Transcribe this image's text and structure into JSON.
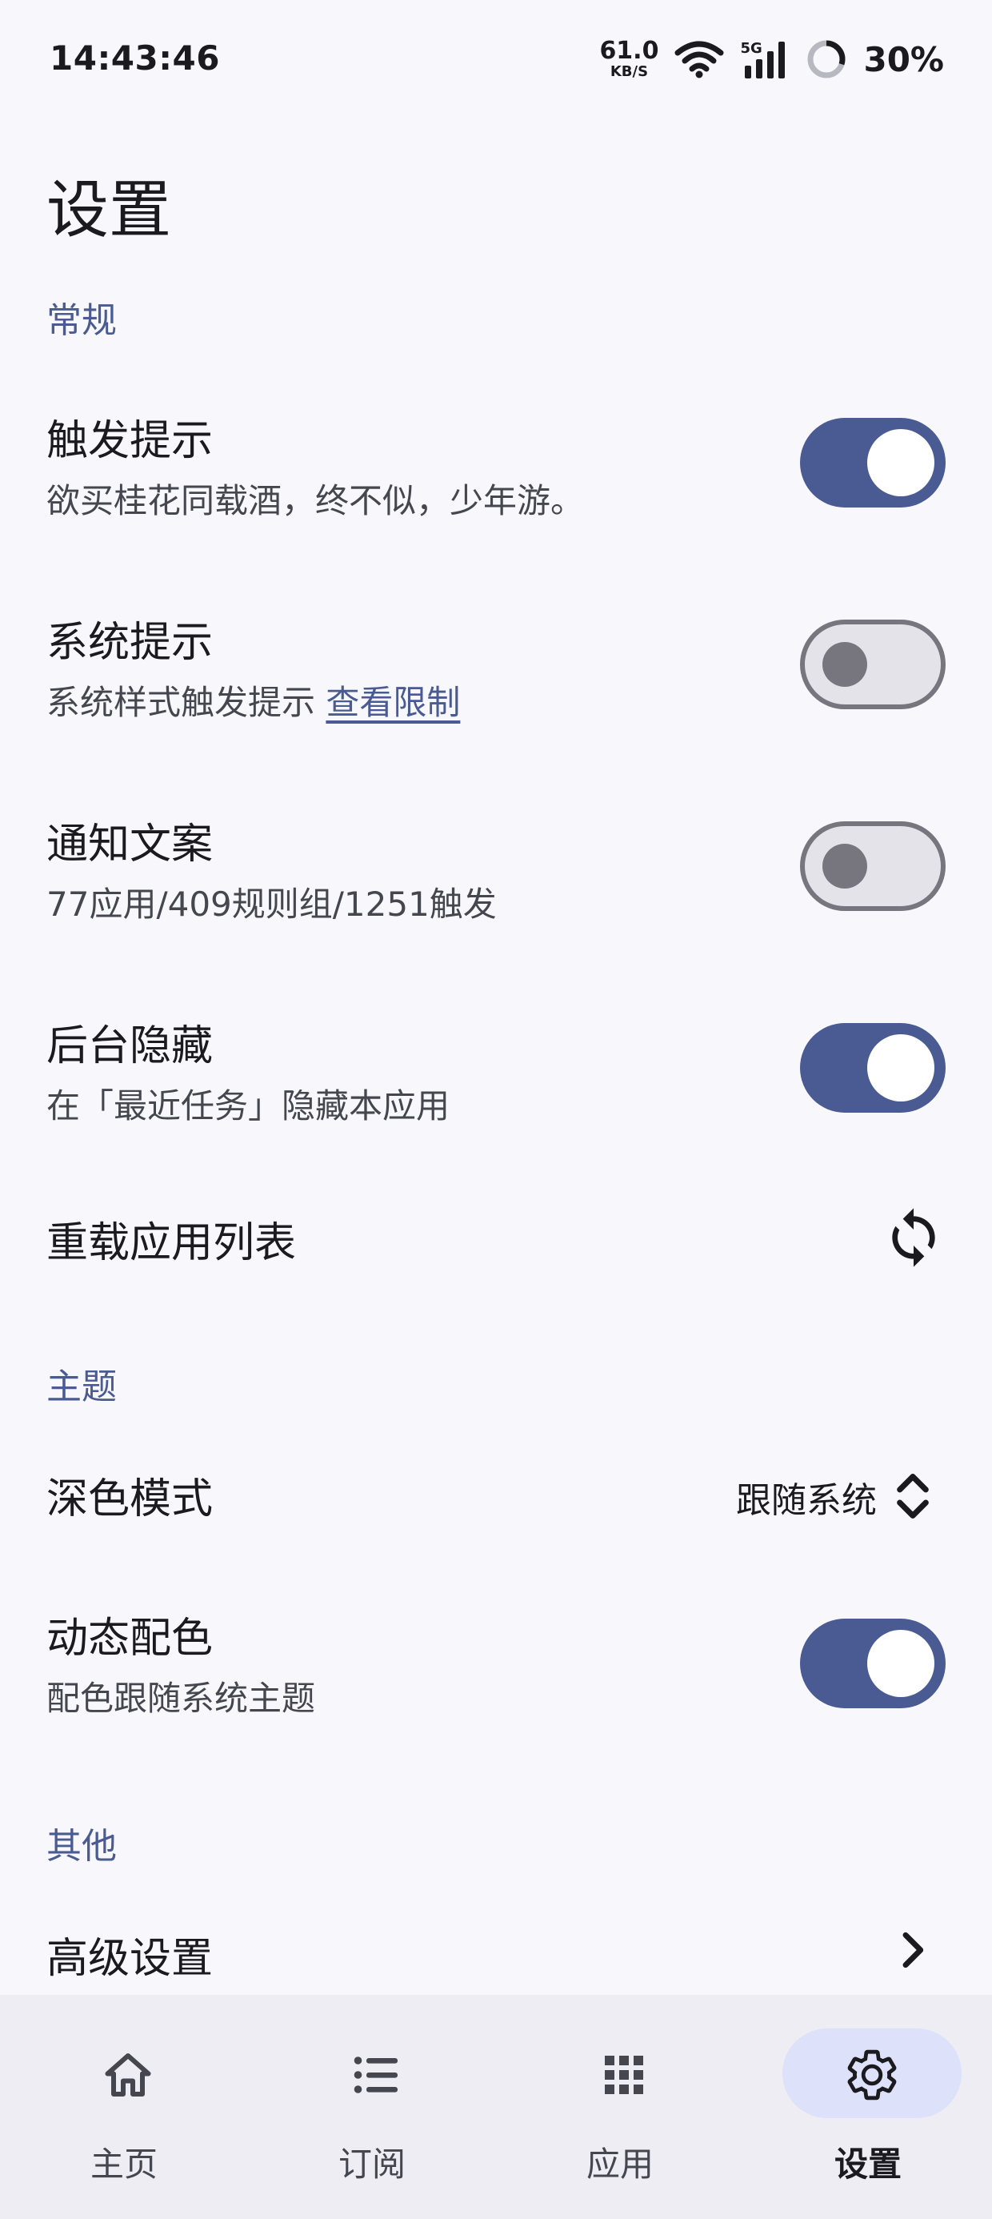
{
  "status_bar": {
    "time": "14:43:46",
    "net_speed_value": "61.0",
    "net_speed_unit": "KB/S",
    "network_type": "5G",
    "battery_percent": "30%",
    "battery_level": 0.3
  },
  "page": {
    "title": "设置"
  },
  "sections": {
    "general": {
      "header": "常规",
      "trigger_tip": {
        "title": "触发提示",
        "subtitle": "欲买桂花同载酒，终不似，少年游。",
        "enabled": true
      },
      "system_tip": {
        "title": "系统提示",
        "subtitle": "系统样式触发提示",
        "link": "查看限制",
        "enabled": false
      },
      "notification_copy": {
        "title": "通知文案",
        "subtitle": "77应用/409规则组/1251触发",
        "enabled": false
      },
      "background_hide": {
        "title": "后台隐藏",
        "subtitle": "在「最近任务」隐藏本应用",
        "enabled": true
      },
      "reload_apps": {
        "title": "重载应用列表",
        "icon": "refresh-icon"
      }
    },
    "theme": {
      "header": "主题",
      "dark_mode": {
        "title": "深色模式",
        "value": "跟随系统",
        "icon": "unfold-icon"
      },
      "dynamic_color": {
        "title": "动态配色",
        "subtitle": "配色跟随系统主题",
        "enabled": true
      }
    },
    "other": {
      "header": "其他",
      "advanced": {
        "title": "高级设置",
        "icon": "chevron-right-icon"
      }
    }
  },
  "bottom_nav": {
    "items": [
      {
        "label": "主页",
        "icon": "home-icon",
        "active": false
      },
      {
        "label": "订阅",
        "icon": "list-icon",
        "active": false
      },
      {
        "label": "应用",
        "icon": "apps-grid-icon",
        "active": false
      },
      {
        "label": "设置",
        "icon": "gear-icon",
        "active": true
      }
    ]
  },
  "colors": {
    "accent": "#4a5a92",
    "background": "#f8f8fc",
    "toggle_off_track": "#e4e3ea",
    "toggle_off_outline": "#77767f",
    "nav_background": "#eeedf4",
    "nav_active_pill": "#dde1f9"
  }
}
